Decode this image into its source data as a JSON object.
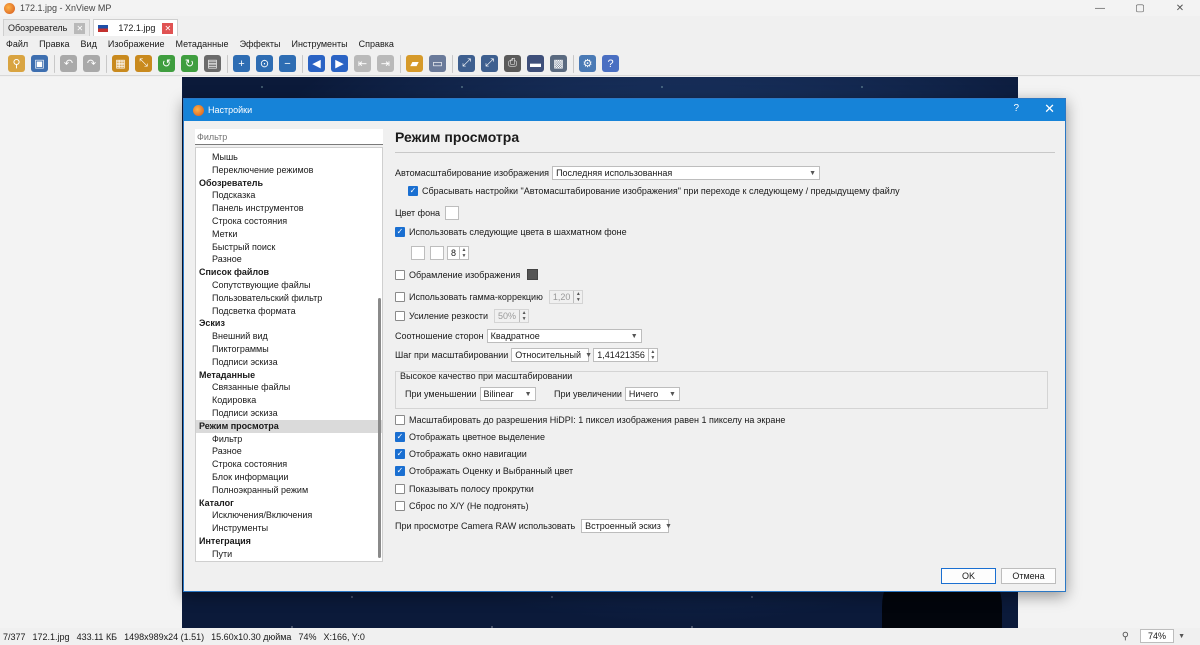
{
  "window": {
    "title": "172.1.jpg - XnView MP",
    "controls": [
      "—",
      "▢",
      "✕"
    ]
  },
  "tabs": [
    {
      "label": "Обозреватель",
      "close": "✕"
    },
    {
      "label": "172.1.jpg",
      "close": "✕"
    }
  ],
  "menu": [
    "Файл",
    "Правка",
    "Вид",
    "Изображение",
    "Метаданные",
    "Эффекты",
    "Инструменты",
    "Справка"
  ],
  "toolbar_icons": [
    {
      "name": "browse-icon",
      "color": "#d9a441",
      "glyph": "⚲"
    },
    {
      "name": "save-icon",
      "color": "#3e6fb0",
      "glyph": "▣"
    },
    {
      "name": "undo-icon",
      "color": "#a9a9a9",
      "glyph": "↶"
    },
    {
      "name": "redo-icon",
      "color": "#a9a9a9",
      "glyph": "↷"
    },
    {
      "name": "crop-icon",
      "color": "#c98a1e",
      "glyph": "▦"
    },
    {
      "name": "resize-icon",
      "color": "#c98a1e",
      "glyph": "⤡"
    },
    {
      "name": "rotate-left-icon",
      "color": "#3f9e3f",
      "glyph": "↺"
    },
    {
      "name": "rotate-right-icon",
      "color": "#3f9e3f",
      "glyph": "↻"
    },
    {
      "name": "adjust-icon",
      "color": "#6a6a6a",
      "glyph": "▤"
    },
    {
      "name": "zoom-in-icon",
      "color": "#2e6db3",
      "glyph": "+"
    },
    {
      "name": "zoom-fit-icon",
      "color": "#2e6db3",
      "glyph": "⊙"
    },
    {
      "name": "zoom-out-icon",
      "color": "#2e6db3",
      "glyph": "−"
    },
    {
      "name": "previous-icon",
      "color": "#2a63c4",
      "glyph": "◀"
    },
    {
      "name": "next-icon",
      "color": "#2a63c4",
      "glyph": "▶"
    },
    {
      "name": "first-icon",
      "color": "#b9b9b9",
      "glyph": "⇤"
    },
    {
      "name": "last-icon",
      "color": "#b9b9b9",
      "glyph": "⇥"
    },
    {
      "name": "slideshow-icon",
      "color": "#d69a2a",
      "glyph": "▰"
    },
    {
      "name": "fullscreen-icon",
      "color": "#6a7a9a",
      "glyph": "▭"
    },
    {
      "name": "fit-window-icon",
      "color": "#3e5f8f",
      "glyph": "⤢"
    },
    {
      "name": "fit-image-icon",
      "color": "#3e5f8f",
      "glyph": "⤢"
    },
    {
      "name": "print-icon",
      "color": "#5a5a5a",
      "glyph": "⎙"
    },
    {
      "name": "scan-icon",
      "color": "#3e4f7a",
      "glyph": "▬"
    },
    {
      "name": "wallpaper-icon",
      "color": "#5a6a80",
      "glyph": "▩"
    },
    {
      "name": "settings-icon",
      "color": "#4a7ab5",
      "glyph": "⚙"
    },
    {
      "name": "help-icon",
      "color": "#4a6fc2",
      "glyph": "?"
    }
  ],
  "statusbar": {
    "index": "7/377",
    "filename": "172.1.jpg",
    "filesize": "433.11 КБ",
    "dimensions": "1498x989x24 (1.51)",
    "print_size": "15.60x10.30 дюйма",
    "zoom": "74%",
    "coords": "X:166, Y:0",
    "zoom_box": "74%"
  },
  "dialog": {
    "title": "Настройки",
    "help": "?",
    "close": "✕",
    "filter_placeholder": "Фильтр",
    "tree": [
      {
        "label": "Мышь",
        "level": "sub"
      },
      {
        "label": "Переключение режимов",
        "level": "sub"
      },
      {
        "label": "Обозреватель",
        "level": "cat"
      },
      {
        "label": "Подсказка",
        "level": "sub"
      },
      {
        "label": "Панель инструментов",
        "level": "sub"
      },
      {
        "label": "Строка состояния",
        "level": "sub"
      },
      {
        "label": "Метки",
        "level": "sub"
      },
      {
        "label": "Быстрый поиск",
        "level": "sub"
      },
      {
        "label": "Разное",
        "level": "sub"
      },
      {
        "label": "Список файлов",
        "level": "cat"
      },
      {
        "label": "Сопутствующие файлы",
        "level": "sub"
      },
      {
        "label": "Пользовательский фильтр",
        "level": "sub"
      },
      {
        "label": "Подсветка формата",
        "level": "sub"
      },
      {
        "label": "Эскиз",
        "level": "cat"
      },
      {
        "label": "Внешний вид",
        "level": "sub"
      },
      {
        "label": "Пиктограммы",
        "level": "sub"
      },
      {
        "label": "Подписи эскиза",
        "level": "sub"
      },
      {
        "label": "Метаданные",
        "level": "cat"
      },
      {
        "label": "Связанные файлы",
        "level": "sub"
      },
      {
        "label": "Кодировка",
        "level": "sub"
      },
      {
        "label": "Подписи эскиза",
        "level": "sub"
      },
      {
        "label": "Режим просмотра",
        "level": "cat",
        "selected": true
      },
      {
        "label": "Фильтр",
        "level": "sub"
      },
      {
        "label": "Разное",
        "level": "sub"
      },
      {
        "label": "Строка состояния",
        "level": "sub"
      },
      {
        "label": "Блок информации",
        "level": "sub"
      },
      {
        "label": "Полноэкранный режим",
        "level": "sub"
      },
      {
        "label": "Каталог",
        "level": "cat"
      },
      {
        "label": "Исключения/Включения",
        "level": "sub"
      },
      {
        "label": "Инструменты",
        "level": "sub"
      },
      {
        "label": "Интеграция",
        "level": "cat"
      },
      {
        "label": "Пути",
        "level": "sub"
      }
    ],
    "page": {
      "heading": "Режим просмотра",
      "autoscale_label": "Автомасштабирование изображения",
      "autoscale_value": "Последняя использованная",
      "reset_autoscale_label": "Сбрасывать настройки \"Автомасштабирование изображения\" при переходе к следующему / предыдущему файлу",
      "reset_autoscale_checked": true,
      "bg_color_label": "Цвет фона",
      "checker_label": "Использовать следующие цвета в шахматном фоне",
      "checker_checked": true,
      "checker_size": "8",
      "frame_label": "Обрамление изображения",
      "frame_checked": false,
      "gamma_label": "Использовать гамма-коррекцию",
      "gamma_checked": false,
      "gamma_value": "1,20",
      "sharpen_label": "Усиление резкости",
      "sharpen_checked": false,
      "sharpen_value": "50%",
      "aspect_label": "Соотношение сторон",
      "aspect_value": "Квадратное",
      "zoom_step_label": "Шаг при масштабировании",
      "zoom_step_mode": "Относительный",
      "zoom_step_value": "1,41421356",
      "hq_group_label": "Высокое качество при масштабировании",
      "downscale_label": "При уменьшении",
      "downscale_value": "Bilinear",
      "upscale_label": "При увеличении",
      "upscale_value": "Ничего",
      "hidpi_label": "Масштабировать до разрешения HiDPI: 1 пиксел изображения равен 1 пикселу на экране",
      "hidpi_checked": false,
      "color_sel_label": "Отображать цветное выделение",
      "color_sel_checked": true,
      "nav_label": "Отображать окно навигации",
      "nav_checked": true,
      "rating_label": "Отображать Оценку и Выбранный цвет",
      "rating_checked": true,
      "scrollbar_label": "Показывать полосу прокрутки",
      "scrollbar_checked": false,
      "reset_xy_label": "Сброс по X/Y (Не подгонять)",
      "reset_xy_checked": false,
      "raw_label": "При просмотре Camera RAW использовать",
      "raw_value": "Встроенный эскиз"
    },
    "ok": "OK",
    "cancel": "Отмена"
  }
}
